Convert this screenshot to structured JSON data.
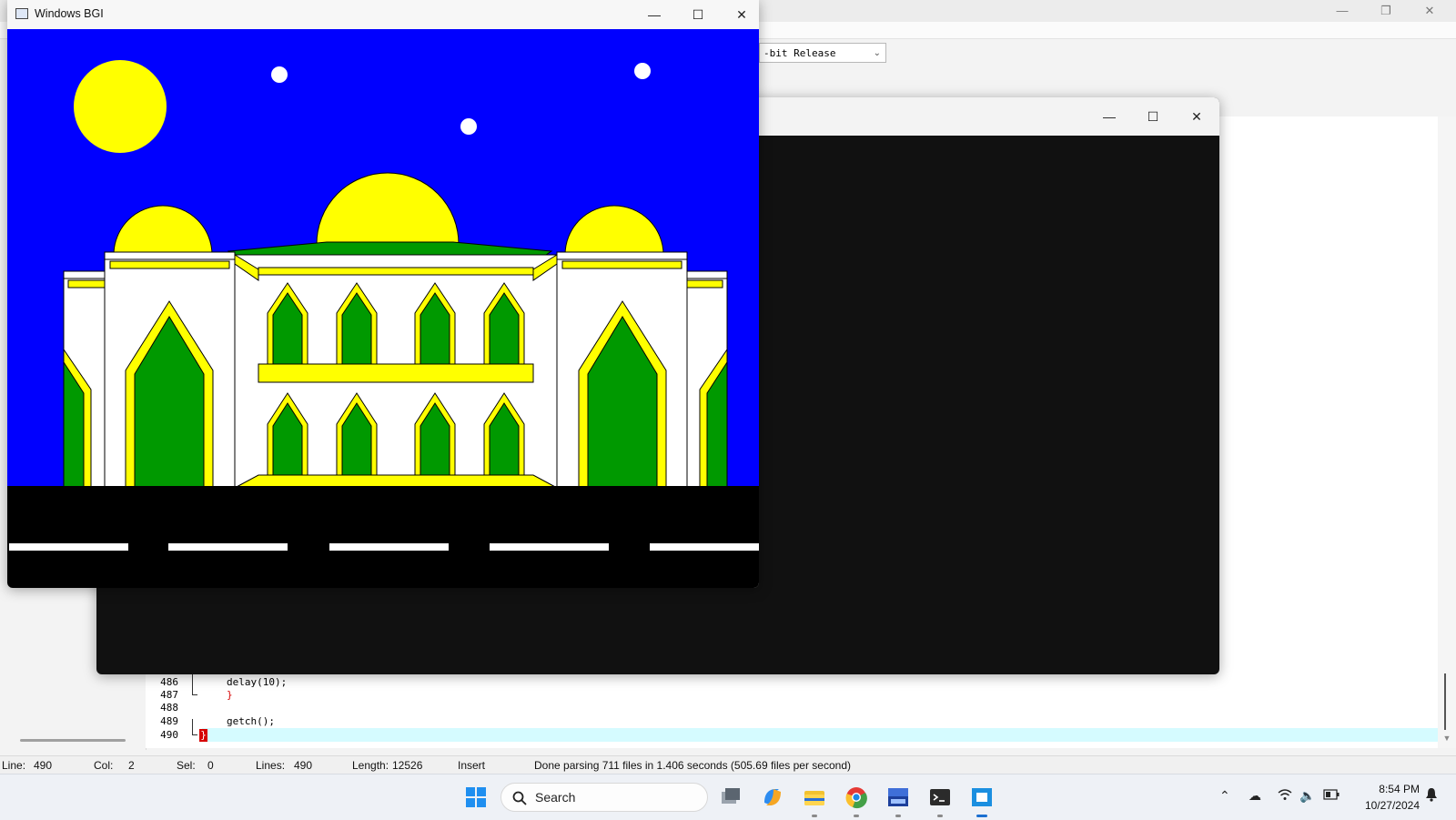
{
  "ide": {
    "build_config": "-bit Release",
    "code_lines": [
      {
        "num": "486",
        "text": "delay(10);"
      },
      {
        "num": "487",
        "text": "}"
      },
      {
        "num": "488",
        "text": ""
      },
      {
        "num": "489",
        "text": "getch();"
      },
      {
        "num": "490",
        "text": "}"
      }
    ],
    "status": {
      "line_label": "Line:",
      "line_value": "490",
      "col_label": "Col:",
      "col_value": "2",
      "sel_label": "Sel:",
      "sel_value": "0",
      "lines_label": "Lines:",
      "lines_value": "490",
      "length_label": "Length:",
      "length_value": "12526",
      "mode": "Insert",
      "message": "Done parsing 711 files in 1.406 seconds (505.69 files per second)"
    }
  },
  "bgi_window": {
    "title": "Windows BGI",
    "colors": {
      "sky": "#0000ff",
      "sun": "#ffff00",
      "wall": "#ffffff",
      "trim": "#ffff00",
      "arch": "#009900",
      "road": "#000000",
      "stripe": "#ffffff"
    }
  },
  "taskbar": {
    "search_label": "Search",
    "icons": [
      "windows-start-icon",
      "task-view-icon",
      "copilot-icon",
      "file-explorer-icon",
      "chrome-icon",
      "dev-cpp-icon",
      "terminal-icon",
      "bgi-app-icon"
    ],
    "time": "8:54 PM",
    "date": "10/27/2024"
  }
}
